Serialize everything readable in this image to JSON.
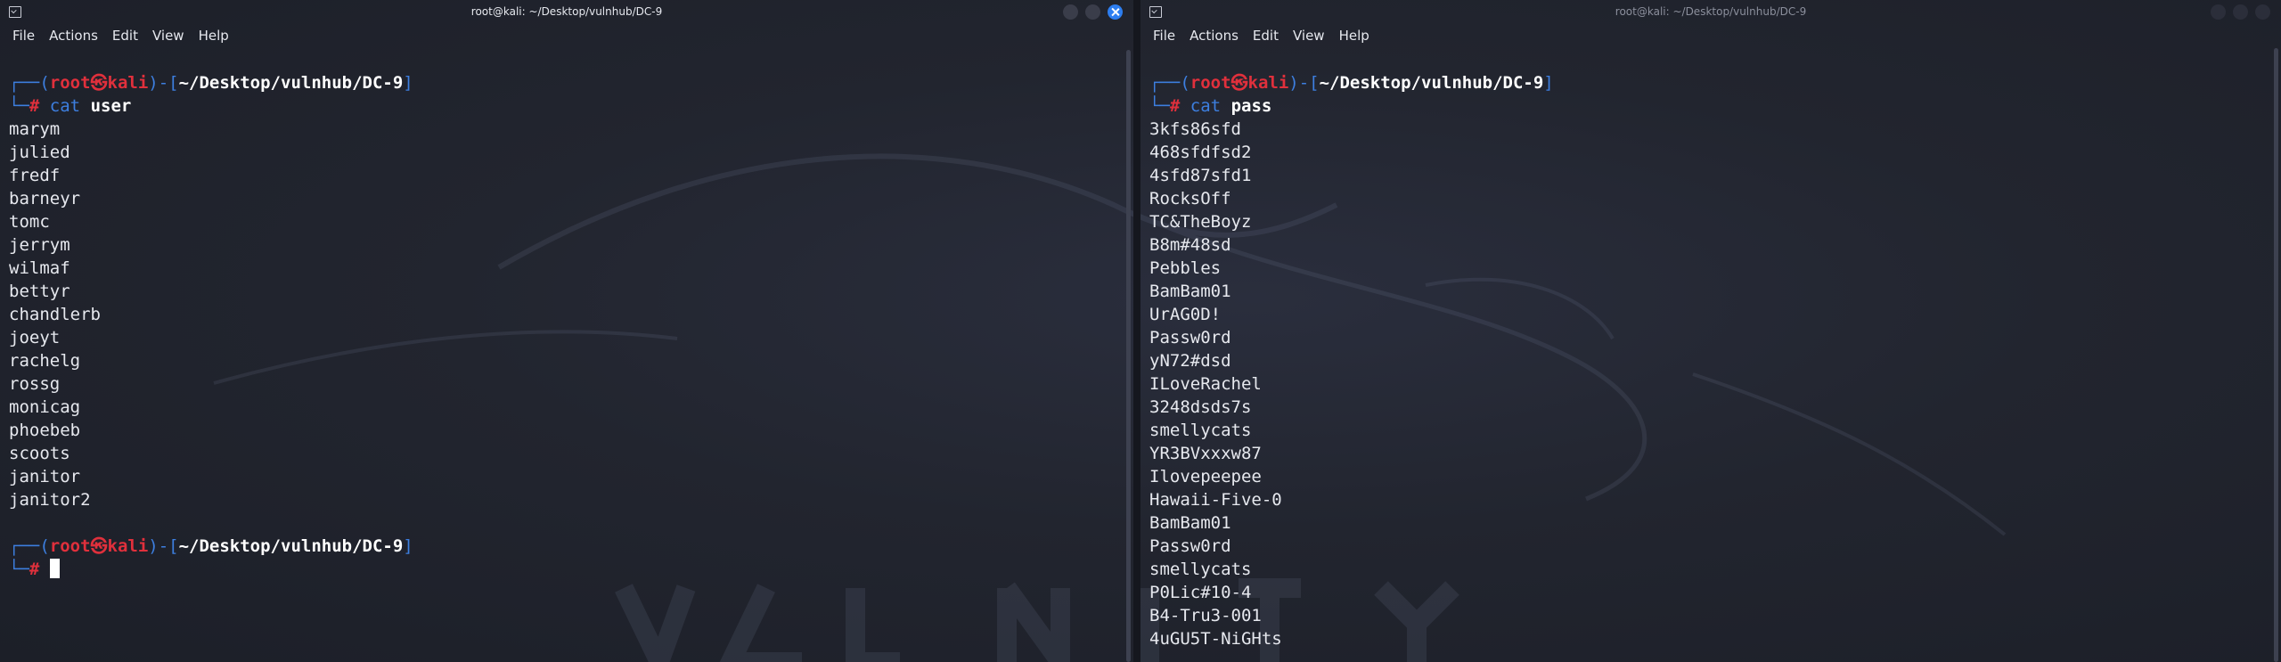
{
  "left_window": {
    "title": "root@kali: ~/Desktop/vulnhub/DC-9",
    "menu": [
      "File",
      "Actions",
      "Edit",
      "View",
      "Help"
    ],
    "prompt1": {
      "corner_top": "┌──(",
      "user": "root㉿kali",
      "sep": ")-[",
      "path": "~/Desktop/vulnhub/DC-9",
      "end": "]",
      "corner_bottom": "└─",
      "hash": "#",
      "cmd": "cat",
      "arg": "user"
    },
    "output": [
      "marym",
      "julied",
      "fredf",
      "barneyr",
      "tomc",
      "jerrym",
      "wilmaf",
      "bettyr",
      "chandlerb",
      "joeyt",
      "rachelg",
      "rossg",
      "monicag",
      "phoebeb",
      "scoots",
      "janitor",
      "janitor2"
    ],
    "prompt2": {
      "corner_top": "┌──(",
      "user": "root㉿kali",
      "sep": ")-[",
      "path": "~/Desktop/vulnhub/DC-9",
      "end": "]",
      "corner_bottom": "└─",
      "hash": "#"
    }
  },
  "right_window": {
    "title": "root@kali: ~/Desktop/vulnhub/DC-9",
    "menu": [
      "File",
      "Actions",
      "Edit",
      "View",
      "Help"
    ],
    "prompt1": {
      "corner_top": "┌──(",
      "user": "root㉿kali",
      "sep": ")-[",
      "path": "~/Desktop/vulnhub/DC-9",
      "end": "]",
      "corner_bottom": "└─",
      "hash": "#",
      "cmd": "cat",
      "arg": "pass"
    },
    "output": [
      "3kfs86sfd",
      "468sfdfsd2",
      "4sfd87sfd1",
      "RocksOff",
      "TC&TheBoyz",
      "B8m#48sd",
      "Pebbles",
      "BamBam01",
      "UrAG0D!",
      "Passw0rd",
      "yN72#dsd",
      "ILoveRachel",
      "3248dsds7s",
      "smellycats",
      "YR3BVxxxw87",
      "Ilovepeepee",
      "Hawaii-Five-0",
      "BamBam01",
      "Passw0rd",
      "smellycats",
      "P0Lic#10-4",
      "B4-Tru3-001",
      "4uGU5T-NiGHts"
    ]
  },
  "colors": {
    "prompt_blue": "#3d7fe0",
    "prompt_red": "#e0303c",
    "close_button": "#2d7ef0",
    "background": "#22252f"
  },
  "icons": [
    "terminal-icon",
    "minimize-icon",
    "maximize-icon",
    "close-icon"
  ]
}
